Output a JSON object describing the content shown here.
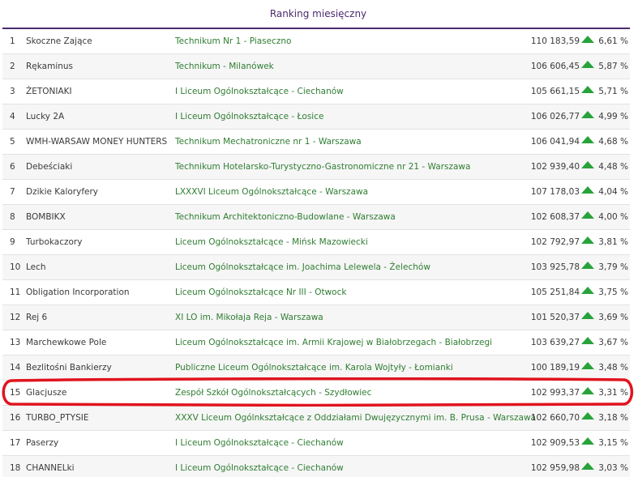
{
  "header": {
    "title": "Ranking miesięczny"
  },
  "ranking": {
    "rows": [
      {
        "rank": "1",
        "team": "Skoczne Zające",
        "school": "Technikum Nr 1 - Piaseczno",
        "value": "110 183,59",
        "pct": "6,61 %",
        "trend": "up"
      },
      {
        "rank": "2",
        "team": "Rękaminus",
        "school": "Technikum - Milanówek",
        "value": "106 606,45",
        "pct": "5,87 %",
        "trend": "up"
      },
      {
        "rank": "3",
        "team": "ŻETONIAKI",
        "school": "I Liceum Ogólnokształcące - Ciechanów",
        "value": "105 661,15",
        "pct": "5,71 %",
        "trend": "up"
      },
      {
        "rank": "4",
        "team": "Lucky 2A",
        "school": "I Liceum Ogólnokształcące - Łosice",
        "value": "106 026,77",
        "pct": "4,99 %",
        "trend": "up"
      },
      {
        "rank": "5",
        "team": "WMH-WARSAW MONEY HUNTERS",
        "school": "Technikum Mechatroniczne nr 1 - Warszawa",
        "value": "106 041,94",
        "pct": "4,68 %",
        "trend": "up"
      },
      {
        "rank": "6",
        "team": "Debeściaki",
        "school": "Technikum Hotelarsko-Turystyczno-Gastronomiczne nr 21 - Warszawa",
        "value": "102 939,40",
        "pct": "4,48 %",
        "trend": "up"
      },
      {
        "rank": "7",
        "team": "Dzikie Kaloryfery",
        "school": "LXXXVI Liceum Ogólnokształcące - Warszawa",
        "value": "107 178,03",
        "pct": "4,04 %",
        "trend": "up"
      },
      {
        "rank": "8",
        "team": "BOMBIKX",
        "school": "Technikum Architektoniczno-Budowlane - Warszawa",
        "value": "102 608,37",
        "pct": "4,00 %",
        "trend": "up"
      },
      {
        "rank": "9",
        "team": "Turbokaczory",
        "school": "Liceum Ogólnokształcące - Mińsk Mazowiecki",
        "value": "102 792,97",
        "pct": "3,81 %",
        "trend": "up"
      },
      {
        "rank": "10",
        "team": "Lech",
        "school": "Liceum Ogólnokształcące im. Joachima Lelewela - Żelechów",
        "value": "103 925,78",
        "pct": "3,79 %",
        "trend": "up"
      },
      {
        "rank": "11",
        "team": "Obligation Incorporation",
        "school": "Liceum Ogólnokształcące Nr III - Otwock",
        "value": "105 251,84",
        "pct": "3,75 %",
        "trend": "up"
      },
      {
        "rank": "12",
        "team": "Rej 6",
        "school": "XI LO im. Mikołaja Reja - Warszawa",
        "value": "101 520,37",
        "pct": "3,69 %",
        "trend": "up"
      },
      {
        "rank": "13",
        "team": "Marchewkowe Pole",
        "school": "Liceum Ogólnokształcące im. Armii Krajowej w Białobrzegach - Białobrzegi",
        "value": "103 639,27",
        "pct": "3,67 %",
        "trend": "up"
      },
      {
        "rank": "14",
        "team": "Bezlitośni Bankierzy",
        "school": "Publiczne Liceum Ogólnokształcące im. Karola Wojtyły - Łomianki",
        "value": "100 189,19",
        "pct": "3,48 %",
        "trend": "up"
      },
      {
        "rank": "15",
        "team": "Glacjusze",
        "school": "Zespół Szkół Ogólnokształcących - Szydłowiec",
        "value": "102 993,37",
        "pct": "3,31 %",
        "trend": "up"
      },
      {
        "rank": "16",
        "team": "TURBO_PTYSIE",
        "school": "XXXV Liceum Ogólnkształcące z Oddziałami Dwujęzycznymi im. B. Prusa - Warszawa",
        "value": "102 660,70",
        "pct": "3,18 %",
        "trend": "up"
      },
      {
        "rank": "17",
        "team": "Paserzy",
        "school": "I Liceum Ogólnokształcące - Ciechanów",
        "value": "102 909,53",
        "pct": "3,15 %",
        "trend": "up"
      },
      {
        "rank": "18",
        "team": "CHANNELki",
        "school": "I Liceum Ogólnokształcące - Ciechanów",
        "value": "102 959,98",
        "pct": "3,03 %",
        "trend": "up"
      }
    ]
  },
  "colors": {
    "title": "#4b2a6e",
    "school_text": "#2f7d32",
    "trend_up": "#28a33b",
    "highlight": "#e0141e"
  },
  "icons": {
    "trend_up": "triangle-up-icon"
  }
}
